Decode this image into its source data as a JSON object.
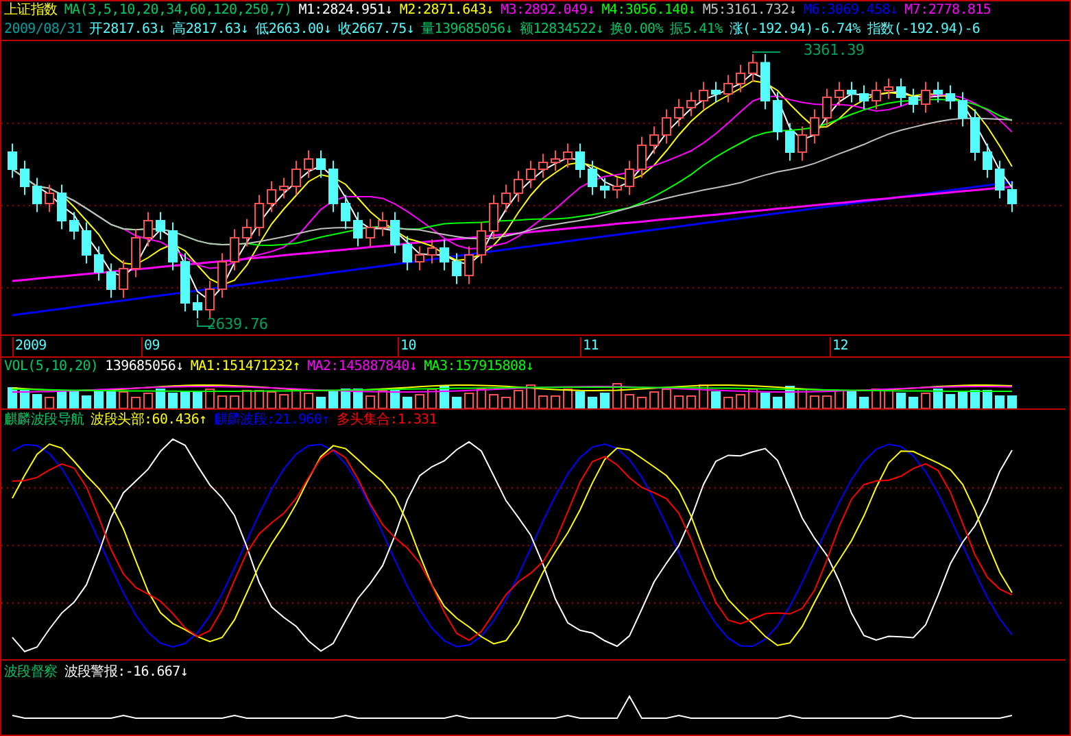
{
  "header": {
    "title": "上证指数",
    "ma_label": "MA(3,5,10,20,34,60,120,250,7)",
    "ma_readings": [
      {
        "text": "M1:2824.951↓",
        "color": "#ffffff"
      },
      {
        "text": "M2:2871.643↓",
        "color": "#ffff00"
      },
      {
        "text": "M3:2892.049↓",
        "color": "#ff00ff"
      },
      {
        "text": "M4:3056.140↓",
        "color": "#00ff00"
      },
      {
        "text": "M5:3161.732↓",
        "color": "#c0c0c0"
      },
      {
        "text": "M6:3069.458↓",
        "color": "#0000ff"
      },
      {
        "text": "M7:2778.815",
        "color": "#ff00ff"
      }
    ],
    "date": "2009/08/31",
    "quote_fields": [
      {
        "text": "开2817.63↓",
        "color": "#54fcfc"
      },
      {
        "text": "高2817.63↓",
        "color": "#54fcfc"
      },
      {
        "text": "低2663.00↓",
        "color": "#54fcfc"
      },
      {
        "text": "收2667.75↓",
        "color": "#54fcfc"
      },
      {
        "text": "量139685056↓",
        "color": "#00c864"
      },
      {
        "text": "额12834522↓",
        "color": "#00c864"
      },
      {
        "text": "换0.00%",
        "color": "#00c864"
      },
      {
        "text": "振5.41%",
        "color": "#00c864"
      },
      {
        "text": "涨(-192.94)-6.74%",
        "color": "#54fcfc"
      },
      {
        "text": "指数(-192.94)-6",
        "color": "#54fcfc"
      }
    ]
  },
  "main_chart": {
    "annotations": [
      {
        "text": "3361.39",
        "kind": "high"
      },
      {
        "text": "2639.76",
        "kind": "low"
      }
    ]
  },
  "date_axis": [
    "2009",
    "09",
    "10",
    "11",
    "12"
  ],
  "volume": {
    "label": "VOL(5,10,20)",
    "readings": [
      {
        "text": "139685056↓",
        "color": "#ffffff"
      },
      {
        "text": "MA1:151471232↑",
        "color": "#ffff00"
      },
      {
        "text": "MA2:145887840↓",
        "color": "#ff00ff"
      },
      {
        "text": "MA3:157915808↓",
        "color": "#00ff00"
      }
    ]
  },
  "indicator": {
    "title": "麒麟波段导航",
    "readings": [
      {
        "text": "波段头部:60.436↑",
        "color": "#ffff00"
      },
      {
        "text": "麒麟波段:21.960↑",
        "color": "#0000ff"
      },
      {
        "text": "多头集合:1.331",
        "color": "#ff0000"
      }
    ]
  },
  "alert": {
    "title": "波段督察",
    "readings": [
      {
        "text": "波段警报:-16.667↓",
        "color": "#ffffff"
      }
    ]
  }
}
